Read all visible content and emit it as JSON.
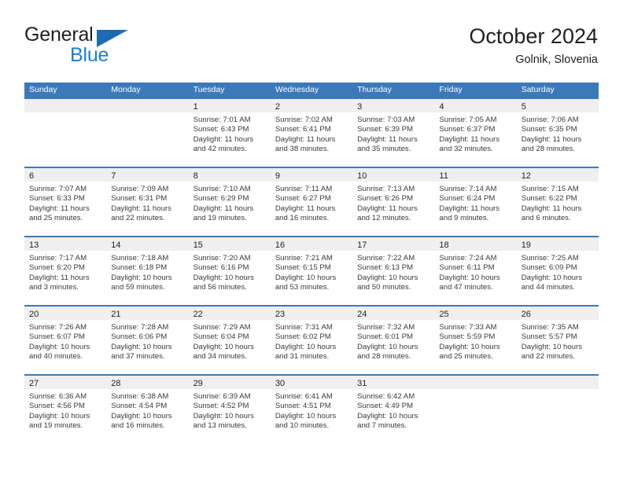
{
  "logo": {
    "word_top": "General",
    "word_bottom": "Blue",
    "triangle_icon": "triangle-icon",
    "brand_blue": "#1a7fd4",
    "triangle_blue": "#1a6cb5"
  },
  "header": {
    "title": "October 2024",
    "subtitle": "Golnik, Slovenia"
  },
  "theme": {
    "header_blue": "#3b79ba",
    "date_band_gray": "#efefef",
    "text_dark": "#231f20"
  },
  "calendar": {
    "weekday_headers": [
      "Sunday",
      "Monday",
      "Tuesday",
      "Wednesday",
      "Thursday",
      "Friday",
      "Saturday"
    ],
    "weeks": [
      [
        {
          "day": "",
          "empty": true
        },
        {
          "day": "",
          "empty": true
        },
        {
          "day": "1",
          "sunrise": "Sunrise: 7:01 AM",
          "sunset": "Sunset: 6:43 PM",
          "daylight_1": "Daylight: 11 hours",
          "daylight_2": "and 42 minutes."
        },
        {
          "day": "2",
          "sunrise": "Sunrise: 7:02 AM",
          "sunset": "Sunset: 6:41 PM",
          "daylight_1": "Daylight: 11 hours",
          "daylight_2": "and 38 minutes."
        },
        {
          "day": "3",
          "sunrise": "Sunrise: 7:03 AM",
          "sunset": "Sunset: 6:39 PM",
          "daylight_1": "Daylight: 11 hours",
          "daylight_2": "and 35 minutes."
        },
        {
          "day": "4",
          "sunrise": "Sunrise: 7:05 AM",
          "sunset": "Sunset: 6:37 PM",
          "daylight_1": "Daylight: 11 hours",
          "daylight_2": "and 32 minutes."
        },
        {
          "day": "5",
          "sunrise": "Sunrise: 7:06 AM",
          "sunset": "Sunset: 6:35 PM",
          "daylight_1": "Daylight: 11 hours",
          "daylight_2": "and 28 minutes."
        }
      ],
      [
        {
          "day": "6",
          "sunrise": "Sunrise: 7:07 AM",
          "sunset": "Sunset: 6:33 PM",
          "daylight_1": "Daylight: 11 hours",
          "daylight_2": "and 25 minutes."
        },
        {
          "day": "7",
          "sunrise": "Sunrise: 7:09 AM",
          "sunset": "Sunset: 6:31 PM",
          "daylight_1": "Daylight: 11 hours",
          "daylight_2": "and 22 minutes."
        },
        {
          "day": "8",
          "sunrise": "Sunrise: 7:10 AM",
          "sunset": "Sunset: 6:29 PM",
          "daylight_1": "Daylight: 11 hours",
          "daylight_2": "and 19 minutes."
        },
        {
          "day": "9",
          "sunrise": "Sunrise: 7:11 AM",
          "sunset": "Sunset: 6:27 PM",
          "daylight_1": "Daylight: 11 hours",
          "daylight_2": "and 16 minutes."
        },
        {
          "day": "10",
          "sunrise": "Sunrise: 7:13 AM",
          "sunset": "Sunset: 6:26 PM",
          "daylight_1": "Daylight: 11 hours",
          "daylight_2": "and 12 minutes."
        },
        {
          "day": "11",
          "sunrise": "Sunrise: 7:14 AM",
          "sunset": "Sunset: 6:24 PM",
          "daylight_1": "Daylight: 11 hours",
          "daylight_2": "and 9 minutes."
        },
        {
          "day": "12",
          "sunrise": "Sunrise: 7:15 AM",
          "sunset": "Sunset: 6:22 PM",
          "daylight_1": "Daylight: 11 hours",
          "daylight_2": "and 6 minutes."
        }
      ],
      [
        {
          "day": "13",
          "sunrise": "Sunrise: 7:17 AM",
          "sunset": "Sunset: 6:20 PM",
          "daylight_1": "Daylight: 11 hours",
          "daylight_2": "and 3 minutes."
        },
        {
          "day": "14",
          "sunrise": "Sunrise: 7:18 AM",
          "sunset": "Sunset: 6:18 PM",
          "daylight_1": "Daylight: 10 hours",
          "daylight_2": "and 59 minutes."
        },
        {
          "day": "15",
          "sunrise": "Sunrise: 7:20 AM",
          "sunset": "Sunset: 6:16 PM",
          "daylight_1": "Daylight: 10 hours",
          "daylight_2": "and 56 minutes."
        },
        {
          "day": "16",
          "sunrise": "Sunrise: 7:21 AM",
          "sunset": "Sunset: 6:15 PM",
          "daylight_1": "Daylight: 10 hours",
          "daylight_2": "and 53 minutes."
        },
        {
          "day": "17",
          "sunrise": "Sunrise: 7:22 AM",
          "sunset": "Sunset: 6:13 PM",
          "daylight_1": "Daylight: 10 hours",
          "daylight_2": "and 50 minutes."
        },
        {
          "day": "18",
          "sunrise": "Sunrise: 7:24 AM",
          "sunset": "Sunset: 6:11 PM",
          "daylight_1": "Daylight: 10 hours",
          "daylight_2": "and 47 minutes."
        },
        {
          "day": "19",
          "sunrise": "Sunrise: 7:25 AM",
          "sunset": "Sunset: 6:09 PM",
          "daylight_1": "Daylight: 10 hours",
          "daylight_2": "and 44 minutes."
        }
      ],
      [
        {
          "day": "20",
          "sunrise": "Sunrise: 7:26 AM",
          "sunset": "Sunset: 6:07 PM",
          "daylight_1": "Daylight: 10 hours",
          "daylight_2": "and 40 minutes."
        },
        {
          "day": "21",
          "sunrise": "Sunrise: 7:28 AM",
          "sunset": "Sunset: 6:06 PM",
          "daylight_1": "Daylight: 10 hours",
          "daylight_2": "and 37 minutes."
        },
        {
          "day": "22",
          "sunrise": "Sunrise: 7:29 AM",
          "sunset": "Sunset: 6:04 PM",
          "daylight_1": "Daylight: 10 hours",
          "daylight_2": "and 34 minutes."
        },
        {
          "day": "23",
          "sunrise": "Sunrise: 7:31 AM",
          "sunset": "Sunset: 6:02 PM",
          "daylight_1": "Daylight: 10 hours",
          "daylight_2": "and 31 minutes."
        },
        {
          "day": "24",
          "sunrise": "Sunrise: 7:32 AM",
          "sunset": "Sunset: 6:01 PM",
          "daylight_1": "Daylight: 10 hours",
          "daylight_2": "and 28 minutes."
        },
        {
          "day": "25",
          "sunrise": "Sunrise: 7:33 AM",
          "sunset": "Sunset: 5:59 PM",
          "daylight_1": "Daylight: 10 hours",
          "daylight_2": "and 25 minutes."
        },
        {
          "day": "26",
          "sunrise": "Sunrise: 7:35 AM",
          "sunset": "Sunset: 5:57 PM",
          "daylight_1": "Daylight: 10 hours",
          "daylight_2": "and 22 minutes."
        }
      ],
      [
        {
          "day": "27",
          "sunrise": "Sunrise: 6:36 AM",
          "sunset": "Sunset: 4:56 PM",
          "daylight_1": "Daylight: 10 hours",
          "daylight_2": "and 19 minutes."
        },
        {
          "day": "28",
          "sunrise": "Sunrise: 6:38 AM",
          "sunset": "Sunset: 4:54 PM",
          "daylight_1": "Daylight: 10 hours",
          "daylight_2": "and 16 minutes."
        },
        {
          "day": "29",
          "sunrise": "Sunrise: 6:39 AM",
          "sunset": "Sunset: 4:52 PM",
          "daylight_1": "Daylight: 10 hours",
          "daylight_2": "and 13 minutes."
        },
        {
          "day": "30",
          "sunrise": "Sunrise: 6:41 AM",
          "sunset": "Sunset: 4:51 PM",
          "daylight_1": "Daylight: 10 hours",
          "daylight_2": "and 10 minutes."
        },
        {
          "day": "31",
          "sunrise": "Sunrise: 6:42 AM",
          "sunset": "Sunset: 4:49 PM",
          "daylight_1": "Daylight: 10 hours",
          "daylight_2": "and 7 minutes."
        },
        {
          "day": "",
          "empty": true
        },
        {
          "day": "",
          "empty": true
        }
      ]
    ]
  }
}
